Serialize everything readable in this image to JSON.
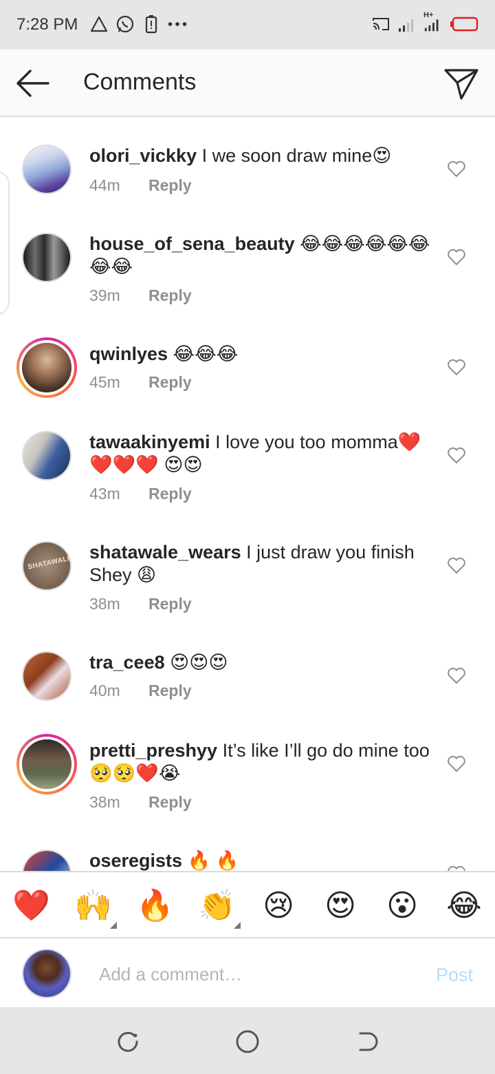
{
  "status_bar": {
    "time": "7:28 PM",
    "left_icons": [
      "warning-icon",
      "whatsapp-icon",
      "battery-saver-icon",
      "more-dots-icon"
    ],
    "right_icons": [
      "cast-icon",
      "signal-icon",
      "signal-4g-icon",
      "battery-icon"
    ],
    "network_label": "H+"
  },
  "header": {
    "title": "Comments",
    "back_icon": "arrow-left-icon",
    "send_icon": "paper-plane-icon"
  },
  "reply_label": "Reply",
  "comments": [
    {
      "username": "olori_vickky",
      "text": " I we soon draw mine😍",
      "time": "44m",
      "avatar_color": "#8fa6d8",
      "story_ring": false
    },
    {
      "username": "house_of_sena_beauty",
      "text": " 😂😂😂😂😂😂😂😂",
      "time": "39m",
      "avatar_color": "#3a3a3a",
      "story_ring": false
    },
    {
      "username": "qwinlyes",
      "text": " 😂😂😂",
      "time": "45m",
      "avatar_color": "#6b4c3b",
      "story_ring": true
    },
    {
      "username": "tawaakinyemi",
      "text": " I love you too momma❤️❤️❤️❤️ 😍😍",
      "time": "43m",
      "avatar_color": "#3c5fa0",
      "story_ring": false
    },
    {
      "username": "shatawale_wears",
      "text": " I just draw you finish Shey 😩",
      "time": "38m",
      "avatar_color": "#8a7563",
      "story_ring": false,
      "avatar_text": "SHATAWALE"
    },
    {
      "username": "tra_cee8",
      "text": " 😍😍😍",
      "time": "40m",
      "avatar_color": "#b05a35",
      "story_ring": false
    },
    {
      "username": "pretti_preshyy",
      "text": " It’s like I’ll go do mine too🥺🥺❤️😭",
      "time": "38m",
      "avatar_color": "#5d6a4f",
      "story_ring": true
    },
    {
      "username": "oseregists",
      "text": " 🔥 🔥",
      "time": "",
      "avatar_color": "#1f4aa0",
      "story_ring": false
    }
  ],
  "emoji_bar": {
    "emojis": [
      "❤️",
      "🙌",
      "🔥",
      "👏",
      "😢",
      "😍",
      "😮",
      "😂"
    ]
  },
  "composer": {
    "placeholder": "Add a comment…",
    "post_label": "Post"
  },
  "colors": {
    "story_ring": [
      "#d6249f",
      "#fd5949",
      "#fdaa3e"
    ],
    "post_disabled": "#b2dffc",
    "secondary_text": "#8e8e8e"
  },
  "nav_bar": {
    "buttons": [
      "recents-icon",
      "home-icon",
      "back-icon"
    ]
  }
}
